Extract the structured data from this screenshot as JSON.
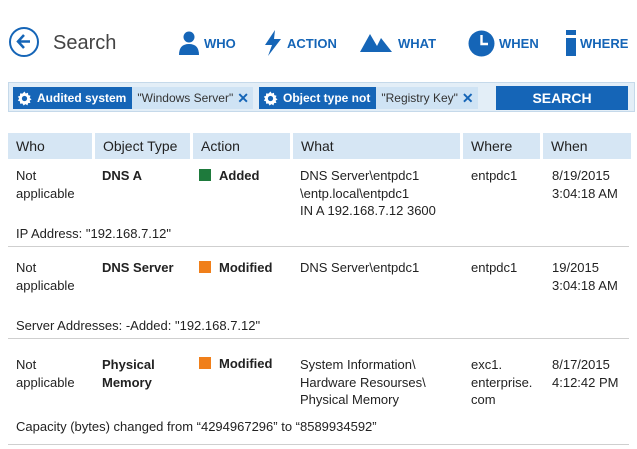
{
  "header": {
    "title": "Search",
    "nav": [
      {
        "label": "WHO",
        "icon": "person-icon"
      },
      {
        "label": "ACTION",
        "icon": "lightning-icon"
      },
      {
        "label": "WHAT",
        "icon": "shapes-icon"
      },
      {
        "label": "WHEN",
        "icon": "clock-icon"
      },
      {
        "label": "WHERE",
        "icon": "where-icon"
      }
    ]
  },
  "filters": [
    {
      "label": "Audited system",
      "value": "\"Windows Server\"",
      "remove": "✕"
    },
    {
      "label": "Object type not",
      "value": "\"Registry Key\"",
      "remove": "✕"
    }
  ],
  "search_button": "SEARCH",
  "columns": [
    "Who",
    "Object Type",
    "Action",
    "What",
    "Where",
    "When"
  ],
  "colors": {
    "accent": "#1565b7",
    "added": "#1e7a3c",
    "modified": "#f07f1a"
  },
  "rows": [
    {
      "who": [
        "Not",
        "applicable"
      ],
      "object_type": [
        "DNS A"
      ],
      "action": "Added",
      "action_color": "#1e7a3c",
      "what": [
        "DNS Server\\entpdc1",
        "\\entp.local\\entpdc1",
        "IN A 192.168.7.12 3600"
      ],
      "where": [
        "entpdc1"
      ],
      "when": [
        "8/19/2015",
        "3:04:18 AM"
      ],
      "detail": "IP Address: \"192.168.7.12\""
    },
    {
      "who": [
        "Not",
        "applicable"
      ],
      "object_type": [
        "DNS Server"
      ],
      "action": "Modified",
      "action_color": "#f07f1a",
      "what": [
        "DNS Server\\entpdc1"
      ],
      "where": [
        "entpdc1"
      ],
      "when": [
        "19/2015",
        "3:04:18 AM"
      ],
      "detail": "Server Addresses:  -Added: \"192.168.7.12\""
    },
    {
      "who": [
        "Not",
        "applicable"
      ],
      "object_type": [
        "Physical",
        "Memory"
      ],
      "action": "Modified",
      "action_color": "#f07f1a",
      "what": [
        "System Information\\",
        "Hardware Resourses\\",
        "Physical Memory"
      ],
      "where": [
        "exc1.",
        "enterprise.",
        "com"
      ],
      "when": [
        "8/17/2015",
        "4:12:42 PM"
      ],
      "detail": "Capacity (bytes) changed from “4294967296” to “8589934592”"
    }
  ]
}
